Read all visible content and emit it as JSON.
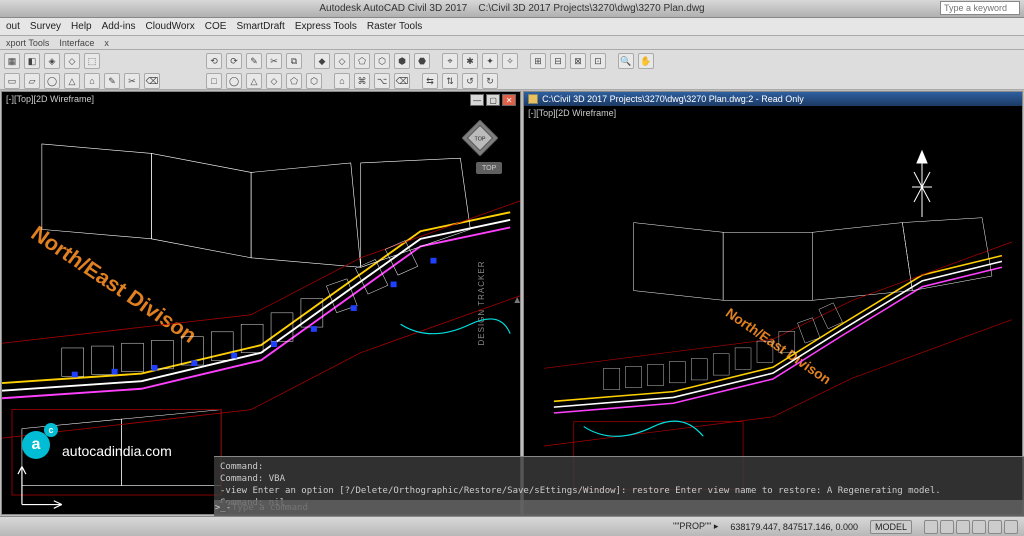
{
  "title_bar": {
    "app": "Autodesk AutoCAD Civil 3D 2017",
    "doc": "C:\\Civil 3D 2017 Projects\\3270\\dwg\\3270 Plan.dwg"
  },
  "search": {
    "placeholder": "Type a keyword"
  },
  "menu": {
    "items": [
      "out",
      "Survey",
      "Help",
      "Add-ins",
      "CloudWorx",
      "COE",
      "SmartDraft",
      "Express Tools",
      "Raster Tools"
    ]
  },
  "subbar": {
    "items": [
      "xport Tools",
      "Interface",
      "x"
    ]
  },
  "viewport_left": {
    "corner_label": "[-][Top][2D Wireframe]",
    "ne_label": "North/East Divison",
    "viewcube_top": "TOP"
  },
  "viewport_right": {
    "title": "C:\\Civil 3D 2017 Projects\\3270\\dwg\\3270 Plan.dwg:2 - Read Only",
    "corner_label": "[-][Top][2D Wireframe]",
    "ne_label": "North/East Divison"
  },
  "watermark": {
    "text": "autocadindia.com",
    "logo_big": "a",
    "logo_small": "c"
  },
  "command_panel": {
    "lines": [
      "Command:",
      "Command: VBA",
      "-view Enter an option [?/Delete/Orthographic/Restore/Save/sEttings/Window]: restore Enter view name to restore: A Regenerating model.",
      "Command: nil"
    ],
    "prompt_prefix": ">_-",
    "prompt_placeholder": "Type a command"
  },
  "status_bar": {
    "prefix": "\"\"PROP\"\"   ▸",
    "coords": "638179.447, 847517.146, 0.000",
    "model_label": "MODEL"
  }
}
